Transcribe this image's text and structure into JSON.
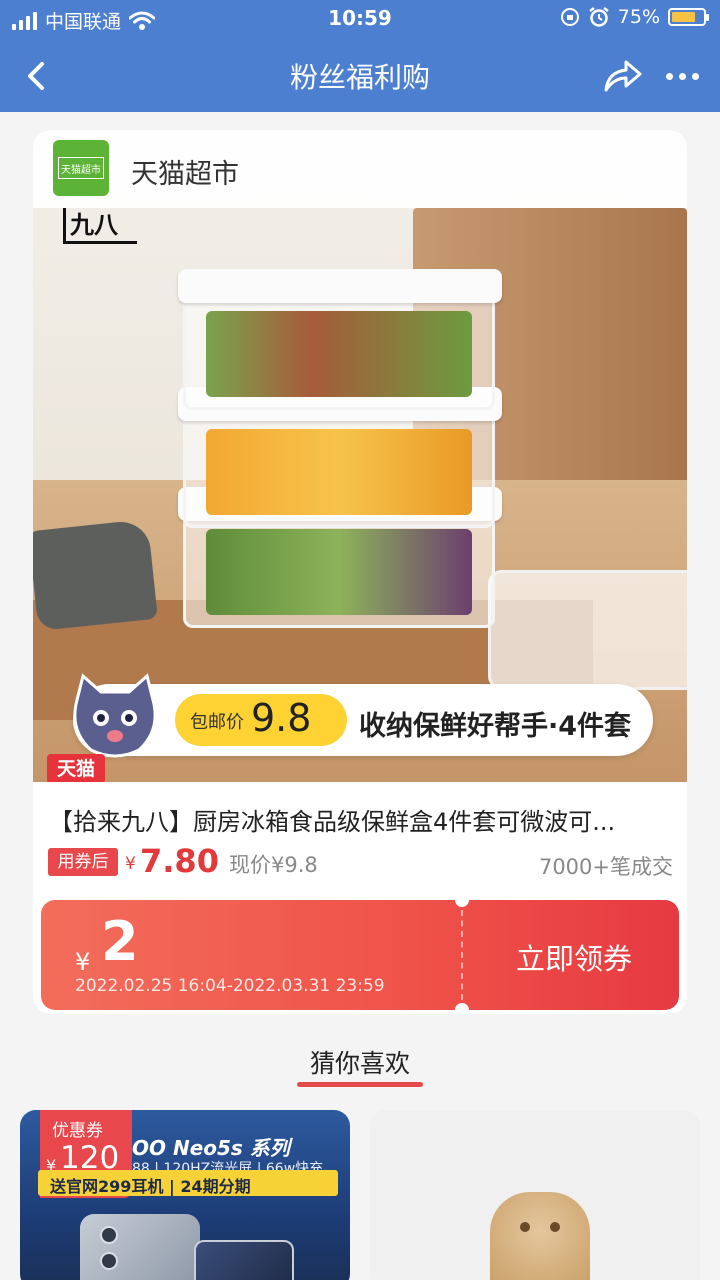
{
  "status_bar": {
    "carrier": "中国联通",
    "time": "10:59",
    "battery_percent": "75%",
    "battery_level": 0.75,
    "icons": [
      "signal-icon",
      "wifi-icon",
      "rotation-lock-icon",
      "alarm-icon",
      "battery-icon"
    ]
  },
  "nav": {
    "title": "粉丝福利购",
    "icons": [
      "back-arrow-icon",
      "share-icon",
      "more-icon"
    ]
  },
  "product": {
    "shop_name": "天猫超市",
    "brand_logo_text": "天猫超市",
    "maker_logo_text": "九八",
    "promo": {
      "price_label": "包邮价",
      "price_value": "9.8",
      "text": "收纳保鲜好帮手·4件套"
    },
    "tmall_tag": "天猫",
    "title": "【拾来九八】厨房冰箱食品级保鲜盒4件套可微波可...",
    "coupon_tag": "用券后",
    "price_symbol": "¥",
    "price": "7.80",
    "original_price": "现价¥9.8",
    "sales": "7000+笔成交"
  },
  "coupon": {
    "symbol": "¥",
    "amount": "2",
    "validity": "2022.02.25 16:04-2022.03.31 23:59",
    "action": "立即领券"
  },
  "recommend": {
    "title": "猜你喜欢",
    "accent_color": "#e54a4a",
    "items": [
      {
        "coupon_label": "优惠券",
        "coupon_symbol": "¥",
        "coupon_amount": "120",
        "headline": "OO Neo5s 系列",
        "specs": "88 | 120HZ流光屏 | 66w快充",
        "gift": "送官网299耳机 | 24期分期"
      },
      {}
    ]
  },
  "colors": {
    "header": "#4d7fd0",
    "price_red": "#e23a3a",
    "coupon_gradient_start": "#f36d5b",
    "coupon_gradient_end": "#e63a42",
    "promo_yellow": "#ffd233"
  }
}
